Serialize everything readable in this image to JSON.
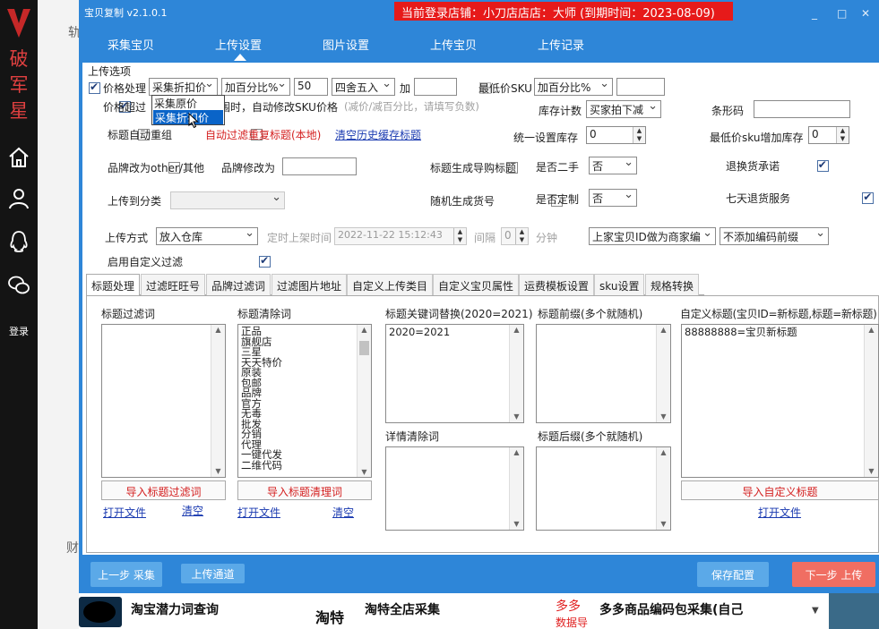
{
  "left_sidebar": {
    "brand_chars": [
      "破",
      "军",
      "星"
    ],
    "login_label": "登录"
  },
  "background_window": {
    "top_char": "轨",
    "bottom_char": "财"
  },
  "window": {
    "app_title": "宝贝复制 v2.1.0.1",
    "store_banner": "当前登录店铺：小刀店店店：大师    (到期时间：2023-08-09)",
    "controls": {
      "minimize": "_",
      "maximize": "□",
      "close": "✕"
    },
    "nav_tabs": [
      "采集宝贝",
      "上传设置",
      "图片设置",
      "上传宝贝",
      "上传记录"
    ],
    "active_nav_tab": "上传设置"
  },
  "upload_options": {
    "group_title": "上传选项",
    "price_processing": {
      "checked": true,
      "label": "价格处理",
      "mode_value": "采集折扣价",
      "mode_options": [
        "采集原价",
        "采集折扣价"
      ],
      "method_value": "加百分比%",
      "amount_value": "50",
      "rounding_value": "四舍五入",
      "plus_label": "加",
      "plus_value": ""
    },
    "min_price_sku": {
      "checked": false,
      "label": "最低价SKU",
      "method_value": "加百分比%",
      "amount_value": ""
    },
    "price_exceed": {
      "checked": true,
      "label_start": "价格超过",
      "label_rest": "范围时，自动修改SKU价格",
      "hint": "(减价/减百分比，请填写负数)"
    },
    "stock_count": {
      "label": "库存计数",
      "value": "买家拍下减"
    },
    "barcode": {
      "label": "条形码",
      "value": ""
    },
    "title_auto_regroup": {
      "checked": false,
      "label": "标题自动重组"
    },
    "auto_filter_dup_title": {
      "checked": false,
      "label": "自动过滤重复标题(本地)"
    },
    "clear_history_link": "清空历史缓存标题",
    "unified_stock": {
      "label": "统一设置库存",
      "value": "0"
    },
    "min_price_sku_add_stock": {
      "label": "最低价sku增加库存",
      "value": "0"
    },
    "brand_to_other": {
      "checked": false,
      "label": "品牌改为other/其他"
    },
    "brand_change_to": {
      "label": "品牌修改为",
      "value": ""
    },
    "title_gen_guide": {
      "checked": false,
      "label": "标题生成导购标题"
    },
    "is_second_hand": {
      "label": "是否二手",
      "value": "否"
    },
    "return_promise": {
      "checked": true,
      "label": "退换货承诺"
    },
    "upload_to_category": {
      "checked": false,
      "label": "上传到分类",
      "value": ""
    },
    "random_item_number": {
      "checked": false,
      "label": "随机生成货号"
    },
    "is_custom": {
      "label": "是否定制",
      "value": "否"
    },
    "seven_day_return": {
      "checked": true,
      "label": "七天退货服务"
    },
    "upload_method": {
      "label": "上传方式",
      "value": "放入仓库"
    },
    "scheduled_listing": {
      "label": "定时上架时间",
      "value": "2022-11-22 15:12:43"
    },
    "interval": {
      "label": "间隔",
      "value": "0",
      "unit": "分钟"
    },
    "merchant_code": {
      "value": "上家宝贝ID做为商家编"
    },
    "code_prefix": {
      "value": "不添加编码前缀"
    },
    "custom_filter": {
      "checked": true,
      "label": "启用自定义过滤"
    }
  },
  "sub_tabs": {
    "items": [
      "标题处理",
      "过滤旺旺号",
      "品牌过滤词",
      "过滤图片地址",
      "自定义上传类目",
      "自定义宝贝属性",
      "运费模板设置",
      "sku设置",
      "规格转换"
    ],
    "active": "标题处理"
  },
  "title_processing": {
    "title_filter_words": {
      "label": "标题过滤词",
      "lines": [],
      "import_button": "导入标题过滤词",
      "open_file_link": "打开文件",
      "clear_link": "清空"
    },
    "title_clear_words": {
      "label": "标题清除词",
      "lines": [
        "正品",
        "旗舰店",
        "三星",
        "天天特价",
        "原装",
        "包邮",
        "品牌",
        "官方",
        "无毒",
        "批发",
        "分销",
        "代理",
        "一键代发",
        "二维代码"
      ],
      "import_button": "导入标题清理词",
      "open_file_link": "打开文件",
      "clear_link": "清空"
    },
    "keyword_replace": {
      "label": "标题关键词替换(2020=2021)",
      "lines": [
        "2020=2021"
      ]
    },
    "detail_clear_words": {
      "label": "详情清除词",
      "lines": []
    },
    "title_prefix": {
      "label": "标题前缀(多个就随机)",
      "lines": []
    },
    "title_suffix": {
      "label": "标题后缀(多个就随机)",
      "lines": []
    },
    "custom_title": {
      "label": "自定义标题(宝贝ID=新标题,标题=新标题)",
      "lines": [
        "88888888=宝贝新标题"
      ],
      "import_button": "导入自定义标题",
      "open_file_link": "打开文件"
    }
  },
  "footer_buttons": {
    "prev_step": "上一步 采集",
    "upload_channel": "上传通道",
    "save_config": "保存配置",
    "next_step": "下一步 上传"
  },
  "taskbar": {
    "items": [
      "淘宝潜力词查询",
      "淘特",
      "淘特全店采集",
      "多多",
      "多多商品编码包采集(自己"
    ],
    "partial_label": "数据导"
  },
  "colors": {
    "window_blue": "#2e86d8",
    "banner_red": "#e61a1a",
    "next_button": "#f06e62",
    "save_button": "#5ba9e8",
    "brand_red": "#e04040"
  }
}
